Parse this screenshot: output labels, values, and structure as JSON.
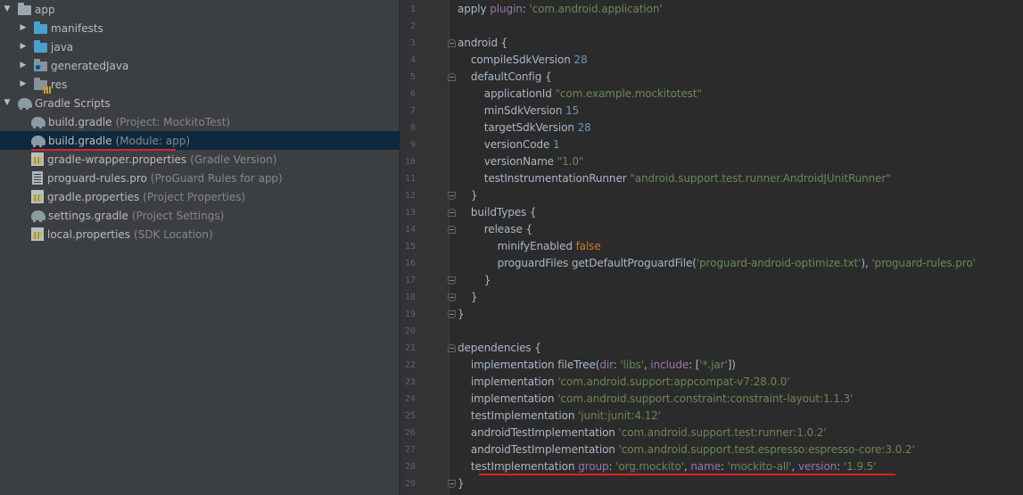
{
  "project_tree": {
    "items": [
      {
        "label": "app",
        "hint": "",
        "arrow": "▼",
        "icon": "folder-icon",
        "selected": false
      },
      {
        "label": "manifests",
        "hint": "",
        "arrow": "▶",
        "icon": "folder-icon",
        "selected": false
      },
      {
        "label": "java",
        "hint": "",
        "arrow": "▶",
        "icon": "folder-icon",
        "selected": false
      },
      {
        "label": "generatedJava",
        "hint": "",
        "arrow": "▶",
        "icon": "generated-folder-icon",
        "selected": false
      },
      {
        "label": "res",
        "hint": "",
        "arrow": "▶",
        "icon": "resources-folder-icon",
        "selected": false
      },
      {
        "label": "Gradle Scripts",
        "hint": "",
        "arrow": "▼",
        "icon": "gradle-icon",
        "selected": false
      },
      {
        "label": "build.gradle",
        "hint": "(Project: MockitoTest)",
        "arrow": "",
        "icon": "gradle-file-icon",
        "selected": false
      },
      {
        "label": "build.gradle",
        "hint": "(Module: app)",
        "arrow": "",
        "icon": "gradle-file-icon",
        "selected": true
      },
      {
        "label": "gradle-wrapper.properties",
        "hint": "(Gradle Version)",
        "arrow": "",
        "icon": "properties-file-icon",
        "selected": false
      },
      {
        "label": "proguard-rules.pro",
        "hint": "(ProGuard Rules for app)",
        "arrow": "",
        "icon": "text-file-icon",
        "selected": false
      },
      {
        "label": "gradle.properties",
        "hint": "(Project Properties)",
        "arrow": "",
        "icon": "properties-file-icon",
        "selected": false
      },
      {
        "label": "settings.gradle",
        "hint": "(Project Settings)",
        "arrow": "",
        "icon": "gradle-file-icon",
        "selected": false
      },
      {
        "label": "local.properties",
        "hint": "(SDK Location)",
        "arrow": "",
        "icon": "properties-file-icon",
        "selected": false
      }
    ]
  },
  "editor": {
    "line_numbers": [
      "1",
      "2",
      "3",
      "4",
      "5",
      "6",
      "7",
      "8",
      "9",
      "10",
      "11",
      "12",
      "13",
      "14",
      "15",
      "16",
      "17",
      "18",
      "19",
      "20",
      "21",
      "22",
      "23",
      "24",
      "25",
      "26",
      "27",
      "28",
      "29"
    ],
    "lines": [
      [
        {
          "t": "apply ",
          "c": "plain"
        },
        {
          "t": "plugin",
          "c": "named"
        },
        {
          "t": ": ",
          "c": "plain"
        },
        {
          "t": "'com.android.application'",
          "c": "str"
        }
      ],
      [],
      [
        {
          "t": "android {",
          "c": "plain"
        }
      ],
      [
        {
          "t": "    compileSdkVersion ",
          "c": "plain"
        },
        {
          "t": "28",
          "c": "num"
        }
      ],
      [
        {
          "t": "    defaultConfig {",
          "c": "plain"
        }
      ],
      [
        {
          "t": "        applicationId ",
          "c": "plain"
        },
        {
          "t": "\"com.example.mockitotest\"",
          "c": "str"
        }
      ],
      [
        {
          "t": "        minSdkVersion ",
          "c": "plain"
        },
        {
          "t": "15",
          "c": "num"
        }
      ],
      [
        {
          "t": "        targetSdkVersion ",
          "c": "plain"
        },
        {
          "t": "28",
          "c": "num"
        }
      ],
      [
        {
          "t": "        versionCode ",
          "c": "plain"
        },
        {
          "t": "1",
          "c": "num"
        }
      ],
      [
        {
          "t": "        versionName ",
          "c": "plain"
        },
        {
          "t": "\"1.0\"",
          "c": "str"
        }
      ],
      [
        {
          "t": "        testInstrumentationRunner ",
          "c": "plain"
        },
        {
          "t": "\"android.support.test.runner.AndroidJUnitRunner\"",
          "c": "str"
        }
      ],
      [
        {
          "t": "    }",
          "c": "plain"
        }
      ],
      [
        {
          "t": "    buildTypes {",
          "c": "plain"
        }
      ],
      [
        {
          "t": "        release {",
          "c": "plain"
        }
      ],
      [
        {
          "t": "            minifyEnabled ",
          "c": "plain"
        },
        {
          "t": "false",
          "c": "kw"
        }
      ],
      [
        {
          "t": "            proguardFiles getDefaultProguardFile(",
          "c": "plain"
        },
        {
          "t": "'proguard-android-optimize.txt'",
          "c": "str"
        },
        {
          "t": "), ",
          "c": "plain"
        },
        {
          "t": "'proguard-rules.pro'",
          "c": "str"
        }
      ],
      [
        {
          "t": "        }",
          "c": "plain"
        }
      ],
      [
        {
          "t": "    }",
          "c": "plain"
        }
      ],
      [
        {
          "t": "}",
          "c": "plain"
        }
      ],
      [],
      [
        {
          "t": "dependencies {",
          "c": "plain"
        }
      ],
      [
        {
          "t": "    implementation fileTree(",
          "c": "plain"
        },
        {
          "t": "dir",
          "c": "named"
        },
        {
          "t": ": ",
          "c": "plain"
        },
        {
          "t": "'libs'",
          "c": "str"
        },
        {
          "t": ", ",
          "c": "plain"
        },
        {
          "t": "include",
          "c": "named"
        },
        {
          "t": ": [",
          "c": "plain"
        },
        {
          "t": "'*.jar'",
          "c": "str"
        },
        {
          "t": "])",
          "c": "plain"
        }
      ],
      [
        {
          "t": "    implementation ",
          "c": "plain"
        },
        {
          "t": "'com.android.support:appcompat-v7:28.0.0'",
          "c": "str"
        }
      ],
      [
        {
          "t": "    implementation ",
          "c": "plain"
        },
        {
          "t": "'com.android.support.constraint:constraint-layout:1.1.3'",
          "c": "str"
        }
      ],
      [
        {
          "t": "    testImplementation ",
          "c": "plain"
        },
        {
          "t": "'junit:junit:4.12'",
          "c": "str"
        }
      ],
      [
        {
          "t": "    androidTestImplementation ",
          "c": "plain"
        },
        {
          "t": "'com.android.support.test:runner:1.0.2'",
          "c": "str"
        }
      ],
      [
        {
          "t": "    androidTestImplementation ",
          "c": "plain"
        },
        {
          "t": "'com.android.support.test.espresso:espresso-core:3.0.2'",
          "c": "str"
        }
      ],
      [
        {
          "t": "    testImplementation ",
          "c": "plain"
        },
        {
          "t": "group",
          "c": "named"
        },
        {
          "t": ": ",
          "c": "plain"
        },
        {
          "t": "'org.mockito'",
          "c": "str"
        },
        {
          "t": ", ",
          "c": "plain"
        },
        {
          "t": "name",
          "c": "named"
        },
        {
          "t": ": ",
          "c": "plain"
        },
        {
          "t": "'mockito-all'",
          "c": "str"
        },
        {
          "t": ", ",
          "c": "plain"
        },
        {
          "t": "version",
          "c": "named"
        },
        {
          "t": ": ",
          "c": "plain"
        },
        {
          "t": "'1.9.5'",
          "c": "str"
        }
      ],
      [
        {
          "t": "}",
          "c": "plain"
        }
      ]
    ]
  },
  "colors": {
    "selection": "#0d293e",
    "annotation_underline": "#e0202d",
    "string": "#6a8759",
    "number": "#6897bb",
    "keyword": "#cc7832"
  }
}
